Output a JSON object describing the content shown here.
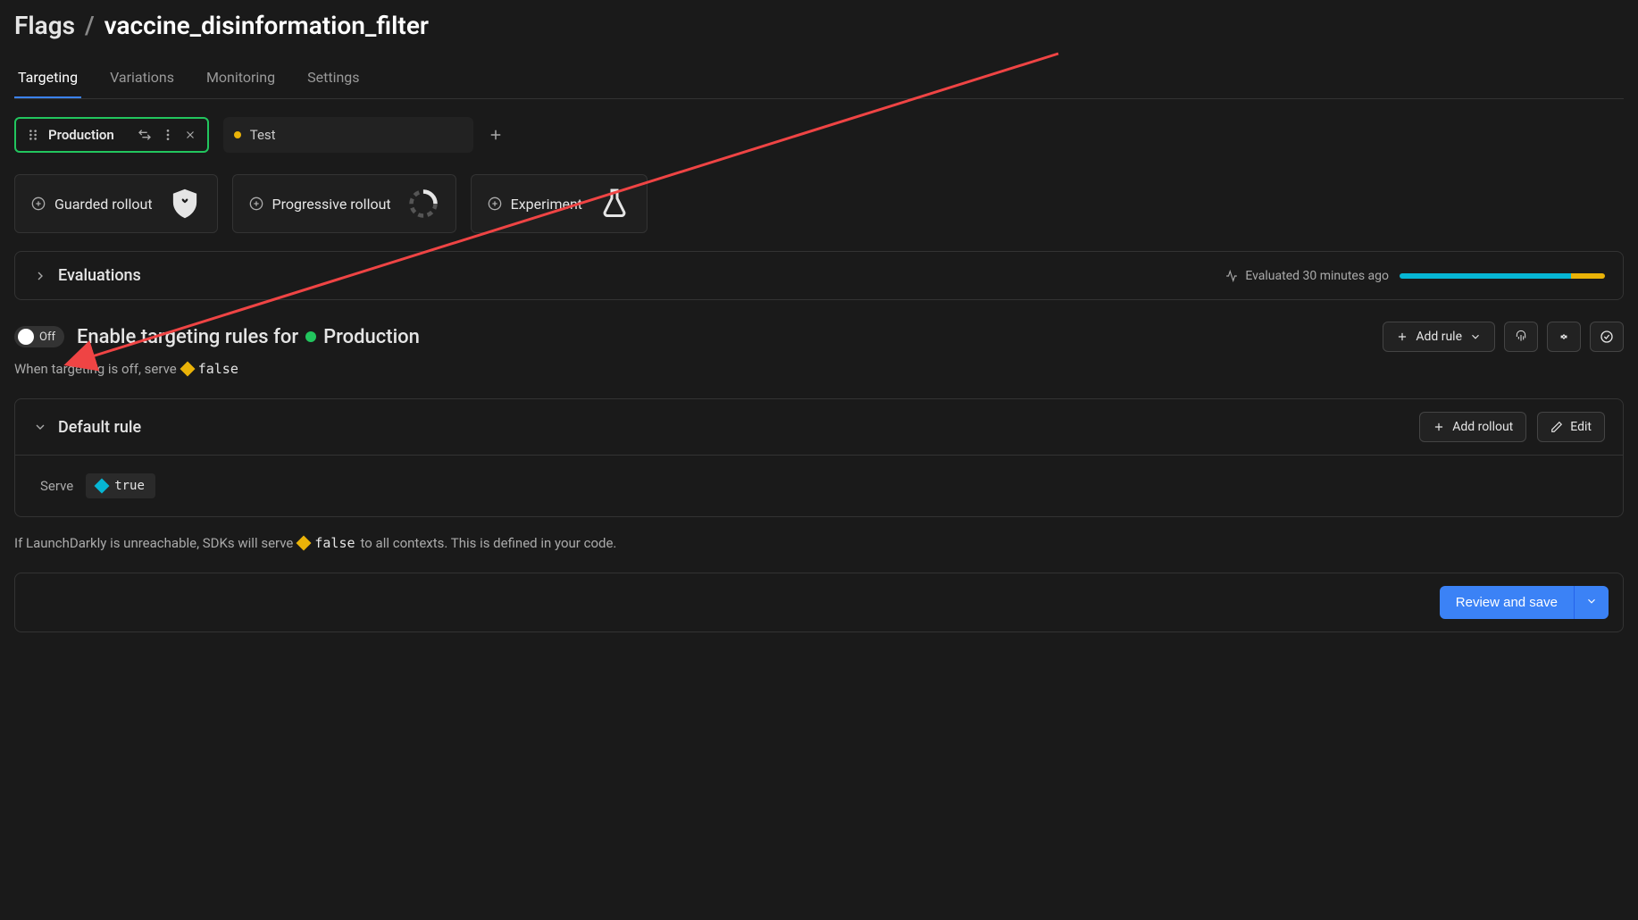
{
  "breadcrumb": {
    "root": "Flags",
    "sep": "/",
    "leaf": "vaccine_disinformation_filter"
  },
  "tabs": [
    "Targeting",
    "Variations",
    "Monitoring",
    "Settings"
  ],
  "active_tab": 0,
  "environments": [
    {
      "label": "Production",
      "color": "#22c55e",
      "active": true
    },
    {
      "label": "Test",
      "color": "#eab308",
      "active": false
    }
  ],
  "rollouts": [
    {
      "label": "Guarded rollout"
    },
    {
      "label": "Progressive rollout"
    },
    {
      "label": "Experiment"
    }
  ],
  "evaluations": {
    "title": "Evaluations",
    "meta": "Evaluated 30 minutes ago"
  },
  "targeting": {
    "toggle_state": "Off",
    "title_prefix": "Enable targeting rules for",
    "env_label": "Production",
    "add_rule": "Add rule",
    "off_serve_prefix": "When targeting is off, serve",
    "off_serve_value": "false"
  },
  "default_rule": {
    "title": "Default rule",
    "add_rollout": "Add rollout",
    "edit": "Edit",
    "serve_label": "Serve",
    "serve_value": "true"
  },
  "fallback": {
    "prefix": "If LaunchDarkly is unreachable, SDKs will serve",
    "value": "false",
    "suffix": "to all contexts. This is defined in your code."
  },
  "save": {
    "label": "Review and save"
  }
}
